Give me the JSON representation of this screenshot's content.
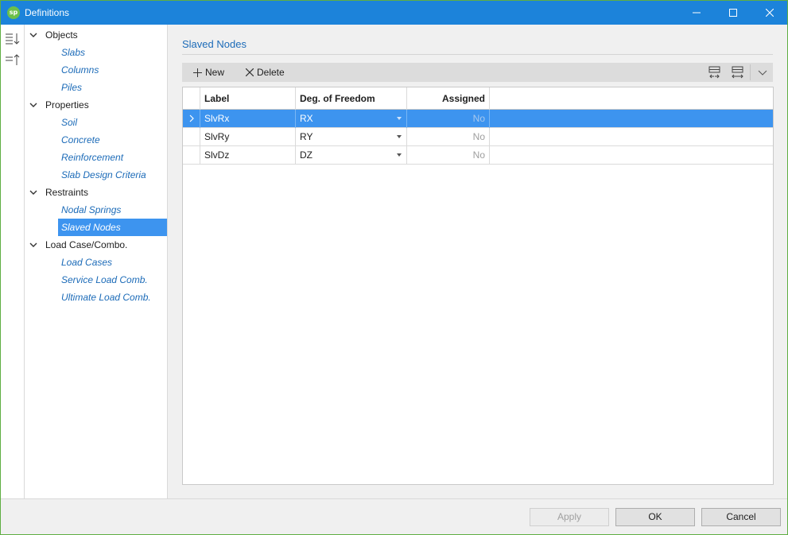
{
  "window": {
    "title": "Definitions",
    "app_logo_text": "sp"
  },
  "toolstrip": {
    "icons": [
      "expand-all-icon",
      "collapse-all-icon"
    ]
  },
  "tree": {
    "groups": [
      {
        "label": "Objects",
        "items": [
          "Slabs",
          "Columns",
          "Piles"
        ]
      },
      {
        "label": "Properties",
        "items": [
          "Soil",
          "Concrete",
          "Reinforcement",
          "Slab Design Criteria"
        ]
      },
      {
        "label": "Restraints",
        "items": [
          "Nodal Springs",
          "Slaved Nodes"
        ]
      },
      {
        "label": "Load Case/Combo.",
        "items": [
          "Load Cases",
          "Service Load Comb.",
          "Ultimate Load Comb."
        ]
      }
    ],
    "selected_item": "Slaved Nodes"
  },
  "panel": {
    "title": "Slaved Nodes",
    "toolbar": {
      "new_label": "New",
      "delete_label": "Delete"
    },
    "grid": {
      "columns": [
        "Label",
        "Deg. of Freedom",
        "Assigned"
      ],
      "rows": [
        {
          "label": "SlvRx",
          "dof": "RX",
          "assigned": "No"
        },
        {
          "label": "SlvRy",
          "dof": "RY",
          "assigned": "No"
        },
        {
          "label": "SlvDz",
          "dof": "DZ",
          "assigned": "No"
        }
      ],
      "selected_row": 0
    }
  },
  "footer": {
    "apply_label": "Apply",
    "ok_label": "OK",
    "cancel_label": "Cancel"
  },
  "colors": {
    "titlebar": "#1c83da",
    "selection": "#3d94ef",
    "link_text": "#1c6bb8",
    "logo": "#6cc04a"
  }
}
